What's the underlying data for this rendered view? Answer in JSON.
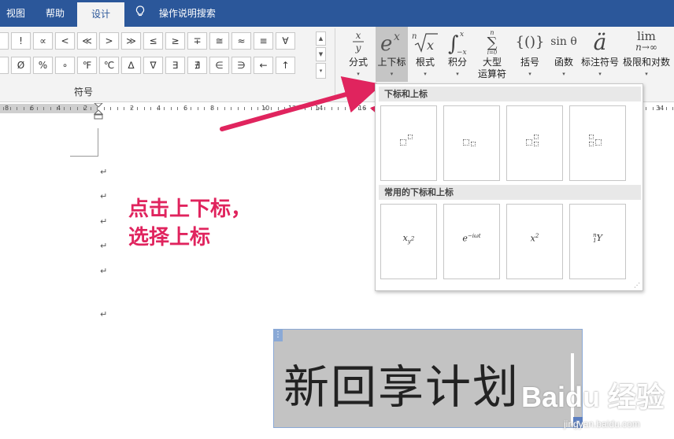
{
  "tabs": [
    {
      "label": "视图",
      "active": false
    },
    {
      "label": "帮助",
      "active": false
    },
    {
      "label": "设计",
      "active": true
    }
  ],
  "tell_me": {
    "icon": "lightbulb-icon",
    "label": "操作说明搜索"
  },
  "symbols": {
    "row1": [
      "·",
      "!",
      "∝",
      "<",
      "≪",
      ">",
      "≫",
      "≤",
      "≥",
      "∓",
      "≅",
      "≈",
      "≡",
      "∀"
    ],
    "row2": [
      "·",
      "Ø",
      "%",
      "∘",
      "℉",
      "℃",
      "∆",
      "∇",
      "∃",
      "∄",
      "∈",
      "∋",
      "←",
      "↑"
    ],
    "group_label": "符号",
    "scroll_up": "▲",
    "scroll_down": "▼",
    "more": "▾"
  },
  "structures": [
    {
      "label": "分式",
      "glyph": "x/y",
      "name": "fraction-button"
    },
    {
      "label": "上下标",
      "glyph": "eˣ",
      "name": "script-button",
      "pressed": true
    },
    {
      "label": "根式",
      "glyph": "ⁿ√x",
      "name": "radical-button"
    },
    {
      "label": "积分",
      "glyph": "∫",
      "name": "integral-button"
    },
    {
      "label": "大型",
      "label2": "运算符",
      "glyph": "∑",
      "name": "large-operator-button"
    },
    {
      "label": "括号",
      "glyph": "{()}",
      "name": "bracket-button"
    },
    {
      "label": "函数",
      "glyph": "sin θ",
      "name": "function-button"
    },
    {
      "label": "标注符号",
      "glyph": "ä",
      "name": "accent-button"
    },
    {
      "label": "极限和对数",
      "glyph": "lim",
      "glyph2": "n→∞",
      "name": "limit-log-button"
    }
  ],
  "ruler": {
    "numbers": [
      "8",
      "6",
      "4",
      "2",
      "2",
      "4",
      "6",
      "8",
      "10",
      "12",
      "14",
      "16",
      "34"
    ]
  },
  "document": {
    "paragraph_mark": "↵",
    "equation_text": "新回享计划",
    "equation_handle": "⋮",
    "equation_dropdown": "▾"
  },
  "annotation": {
    "line1": "点击上下标，",
    "line2": "选择上标",
    "color": "#e0245e"
  },
  "dropdown": {
    "section1_title": "下标和上标",
    "section2_title": "常用的下标和上标",
    "templates": [
      "superscript",
      "subscript",
      "subscript-superscript",
      "left-subscript-superscript"
    ],
    "common": [
      {
        "base": "x",
        "sub": "y",
        "sub2": "2"
      },
      {
        "base": "e",
        "sup": "−iωt"
      },
      {
        "base": "x",
        "sup": "2"
      },
      {
        "pre_sup": "n",
        "pre_sub": "1",
        "base": "Y"
      }
    ],
    "resize_grip": "⋰"
  },
  "watermark": {
    "brand": "Baidu 经验",
    "url": "jingyan.baidu.com"
  }
}
